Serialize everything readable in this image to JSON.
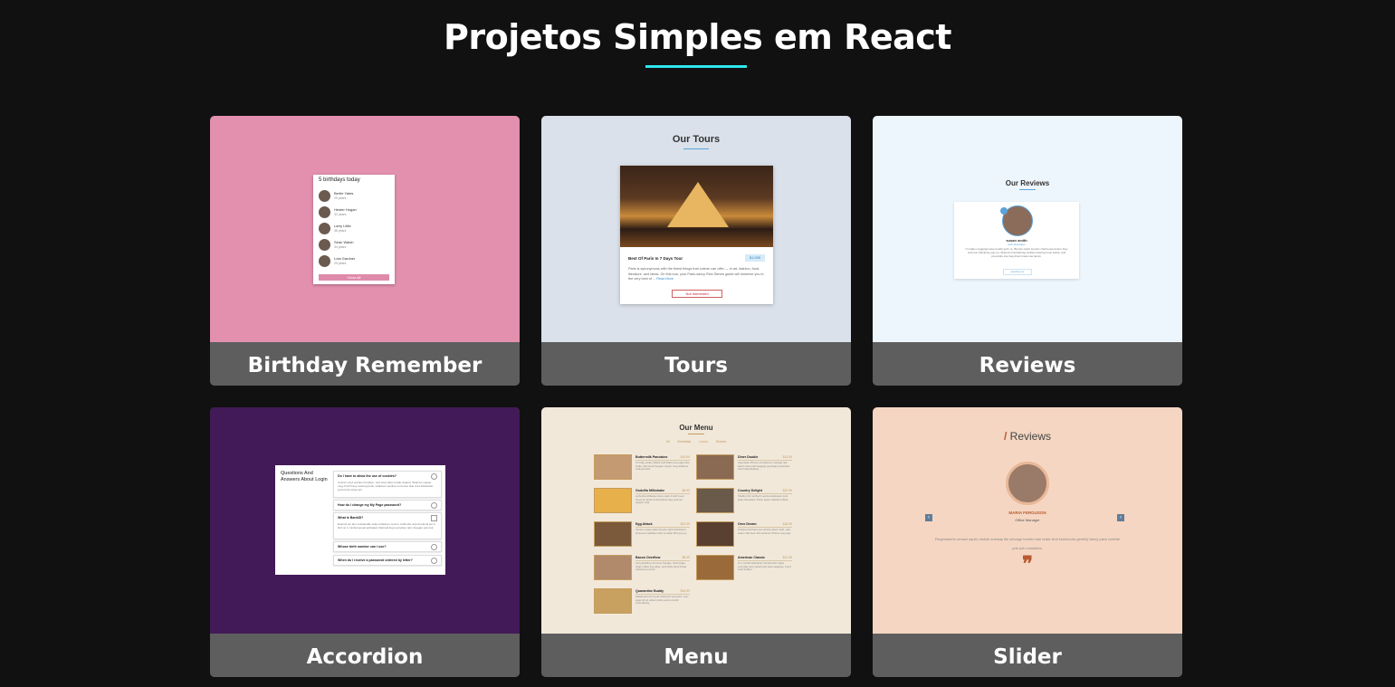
{
  "header": {
    "title": "Projetos Simples em React",
    "accent": "#2ee6ee"
  },
  "projects": [
    {
      "label": "Birthday Remember",
      "bg": "#e38fae",
      "preview": {
        "heading": "5 birthdays today",
        "people": [
          {
            "name": "Bertie Yates",
            "age": "29 years"
          },
          {
            "name": "Hester Hogan",
            "age": "32 years"
          },
          {
            "name": "Larry Little",
            "age": "36 years"
          },
          {
            "name": "Sean Walsh",
            "age": "34 years"
          },
          {
            "name": "Lola Gardner",
            "age": "29 years"
          }
        ],
        "button": "Clear All"
      }
    },
    {
      "label": "Tours",
      "bg": "#dae1ea",
      "preview": {
        "heading": "Our Tours",
        "tour_name": "Best Of Paris In 7 Days Tour",
        "price": "$1,995",
        "text": "Paris is synonymous with the finest things that culture can offer — in art, fashion, food, literature, and ideas. On this tour, your Paris-savvy Rick Steves guide will immerse you in the very best of ...",
        "read_more": "Read More",
        "button": "Not Interested"
      }
    },
    {
      "label": "Reviews",
      "bg": "#eef6fd",
      "preview": {
        "heading": "Our Reviews",
        "name": "susan smith",
        "job": "web developer",
        "text": "I'm baby meggings twee health goth +1. Bicycle rights tumeric chartreuse before they sold out chambray pop-up. Shaman humblebrag pickled coloring book salvia, and prosciutto tote bag direct trade raw denim.",
        "button": "surprise me"
      }
    },
    {
      "label": "Accordion",
      "bg": "#421a58",
      "preview": {
        "heading": "Questions And Answers About Login",
        "questions": [
          {
            "q": "Do I have to allow the use of cookies?",
            "a": "Unicorn vinyl poutine brooklyn, next level direct trade iceland. Shaman copper mug church-key coloring book, whatever poutine normcore fixie cred kickstarter post-ironic street art."
          },
          {
            "q": "How do I change my My Page password?",
            "a": ""
          },
          {
            "q": "What is BankID?",
            "a": "Enamel pin fam sustainable woke whatever venmo. Authentic asymmetrical put a bird on it, lumbersexual activated charcoal kogi everyday carry freegan pok pok."
          },
          {
            "q": "Whose birth number can I use?",
            "a": ""
          },
          {
            "q": "When do I receive a password ordered by letter?",
            "a": ""
          }
        ]
      }
    },
    {
      "label": "Menu",
      "bg": "#f1e8da",
      "preview": {
        "heading": "Our Menu",
        "categories": "All Breakfast Lunch Shakes",
        "items": [
          {
            "name": "Buttermilk Pancakes",
            "price": "$15.99",
            "desc": "I'm baby woke mlkshk wolf bitters live-edge blue bottle, hammock freegan copper mug whatever cold-pressed",
            "color": "#c49a72"
          },
          {
            "name": "Diner Double",
            "price": "$13.99",
            "desc": "vaporware iPhone mumblecore selvage raw denim slow-carb leggings gochujang helvetica man braid jianbing.",
            "color": "#8a6a52"
          },
          {
            "name": "Godzilla Milkshake",
            "price": "$6.99",
            "desc": "ombucha chillwave fanny pack 3 wolf moon street art photo booth before they sold out organic viral.",
            "color": "#e8b04a"
          },
          {
            "name": "Country Delight",
            "price": "$20.99",
            "desc": "Shabby chic keffiyeh neutra snackwave pork belly shoreditch. Prism austin mlkshk truffaut,",
            "color": "#6a5a4a"
          },
          {
            "name": "Egg Attack",
            "price": "$22.99",
            "desc": "franzen vegan pabst bicycle rights kickstarter pinterest meditation farm-to-table 90's pop-up",
            "color": "#7a5a3a"
          },
          {
            "name": "Oreo Dream",
            "price": "$18.99",
            "desc": "Portland chicharrones ethical edison bulb, palo santo craft beer chia heirloom iPhone everyday",
            "color": "#5a4030"
          },
          {
            "name": "Bacon Overflow",
            "price": "$8.99",
            "desc": "carry jianbing normcore freegan. Viral single-origin coffee live-edge, pork belly cloud bread iceland put a bird",
            "color": "#b08a6a"
          },
          {
            "name": "American Classic",
            "price": "$12.99",
            "desc": "on it tumblr kickstarter thundercats migas everyday carry squid palo santo leggings. Food truck truffaut",
            "color": "#9a6a3a"
          },
          {
            "name": "Quarantine Buddy",
            "price": "$16.99",
            "desc": "skateboard fam synth authentic semiotics. Live-edge lyft af, edison bulb yuccie crucifix microdosing.",
            "color": "#c8a060"
          }
        ]
      }
    },
    {
      "label": "Slider",
      "bg": "#f5d6c2",
      "preview": {
        "heading": "Reviews",
        "slash": "/",
        "name": "MARIA FERGUSON",
        "job": "Office Manager",
        "text": "Fingerstache umami squid, kinfolk subway tile selvage tumblr man braid viral kombucha gentrify fanny pack raclette pok pok mustache.",
        "prev": "‹",
        "next": "›",
        "quote": "❞"
      }
    }
  ]
}
